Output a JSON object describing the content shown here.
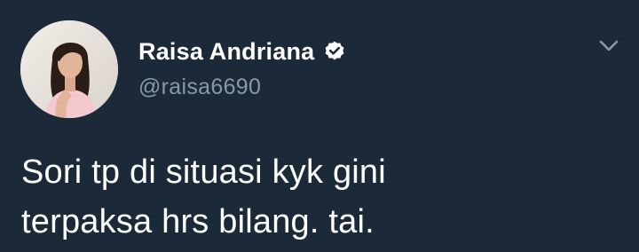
{
  "tweet": {
    "author": {
      "display_name": "Raisa Andriana",
      "handle": "@raisa6690",
      "verified": true,
      "avatar_icon": "profile-photo"
    },
    "text": "Sori tp di situasi kyk gini\nterpaksa hrs bilang. tai.",
    "menu_icon": "chevron-down-icon"
  },
  "colors": {
    "background": "#1c2938",
    "text_primary": "#ffffff",
    "text_secondary": "#8899a6",
    "verified_badge": "#ffffff",
    "chevron": "#8899a6"
  }
}
